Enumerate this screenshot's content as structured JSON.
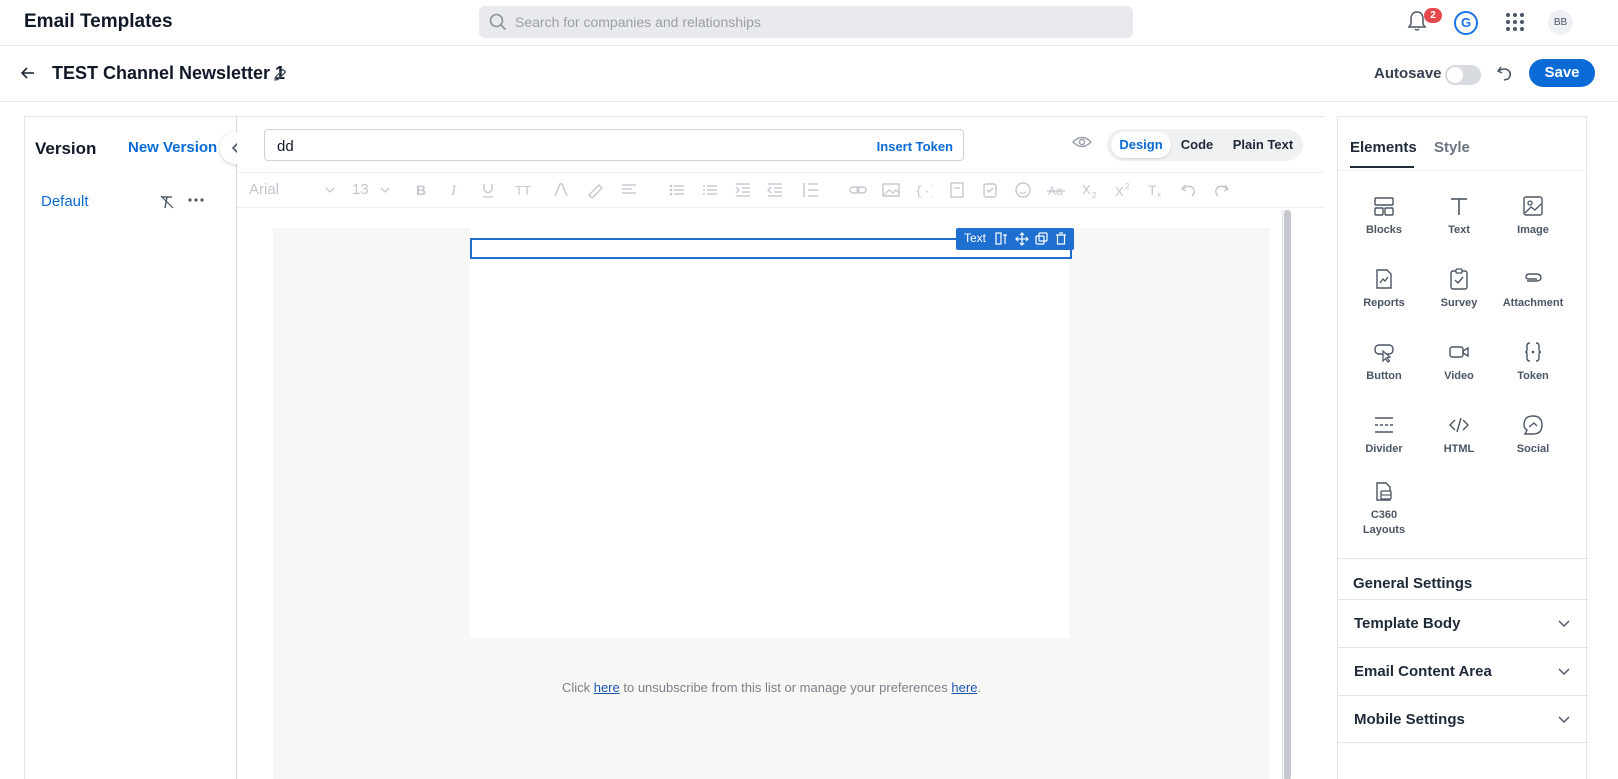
{
  "header": {
    "app_title": "Email Templates",
    "search_placeholder": "Search for companies and relationships",
    "notification_count": "2",
    "g_logo": "G",
    "avatar_initials": "BB"
  },
  "subheader": {
    "template_name": "TEST Channel Newsletter 1",
    "autosave_label": "Autosave",
    "autosave_on": false,
    "save_label": "Save"
  },
  "versions": {
    "title": "Version",
    "new_version_label": "New Version",
    "items": [
      {
        "label": "Default"
      }
    ]
  },
  "editor": {
    "subject_value": "dd",
    "insert_token_label": "Insert Token",
    "modes": [
      {
        "label": "Design",
        "active": true
      },
      {
        "label": "Code",
        "active": false
      },
      {
        "label": "Plain Text",
        "active": false
      }
    ],
    "toolbar": {
      "font": "Arial",
      "size": "13"
    },
    "block_toolbar_label": "Text",
    "footer": {
      "pre": "Click ",
      "link1": "here",
      "mid": " to unsubscribe from this list or manage your preferences ",
      "link2": "here",
      "post": "."
    }
  },
  "right_panel": {
    "tabs": [
      {
        "label": "Elements",
        "active": true
      },
      {
        "label": "Style",
        "active": false
      }
    ],
    "elements": [
      {
        "label": "Blocks",
        "icon": "blocks-icon"
      },
      {
        "label": "Text",
        "icon": "text-icon"
      },
      {
        "label": "Image",
        "icon": "image-icon"
      },
      {
        "label": "Reports",
        "icon": "reports-icon"
      },
      {
        "label": "Survey",
        "icon": "survey-icon"
      },
      {
        "label": "Attachment",
        "icon": "attachment-icon"
      },
      {
        "label": "Button",
        "icon": "button-icon"
      },
      {
        "label": "Video",
        "icon": "video-icon"
      },
      {
        "label": "Token",
        "icon": "token-icon"
      },
      {
        "label": "Divider",
        "icon": "divider-icon"
      },
      {
        "label": "HTML",
        "icon": "html-icon"
      },
      {
        "label": "Social",
        "icon": "social-icon"
      },
      {
        "label": "C360 Layouts",
        "icon": "layouts-icon"
      }
    ],
    "general_settings_title": "General Settings",
    "accordions": [
      {
        "label": "Template Body"
      },
      {
        "label": "Email Content Area"
      },
      {
        "label": "Mobile Settings"
      }
    ]
  },
  "colors": {
    "accent": "#0b6bd6",
    "selection": "#1f6fd1",
    "badge": "#e5484d"
  }
}
